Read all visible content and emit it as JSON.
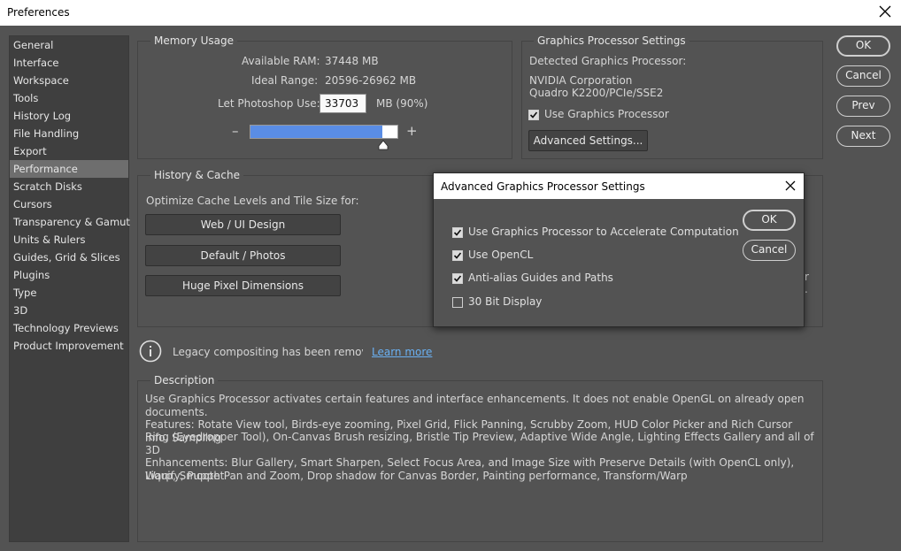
{
  "window": {
    "title": "Preferences"
  },
  "sidebar": {
    "items": [
      {
        "label": "General"
      },
      {
        "label": "Interface"
      },
      {
        "label": "Workspace"
      },
      {
        "label": "Tools"
      },
      {
        "label": "History Log"
      },
      {
        "label": "File Handling"
      },
      {
        "label": "Export"
      },
      {
        "label": "Performance"
      },
      {
        "label": "Scratch Disks"
      },
      {
        "label": "Cursors"
      },
      {
        "label": "Transparency & Gamut"
      },
      {
        "label": "Units & Rulers"
      },
      {
        "label": "Guides, Grid & Slices"
      },
      {
        "label": "Plugins"
      },
      {
        "label": "Type"
      },
      {
        "label": "3D"
      },
      {
        "label": "Technology Previews"
      },
      {
        "label": "Product Improvement"
      }
    ],
    "active": "Performance"
  },
  "memory": {
    "title": "Memory Usage",
    "available_label": "Available RAM:",
    "available_value": "37448 MB",
    "ideal_label": "Ideal Range:",
    "ideal_value": "20596-26962 MB",
    "let_label": "Let Photoshop Use:",
    "let_value": "33703",
    "let_unit": "MB (90%)",
    "minus": "–",
    "plus": "+",
    "slider_fraction": 0.9
  },
  "gpu": {
    "title": "Graphics Processor Settings",
    "detected_label": "Detected Graphics Processor:",
    "vendor": "NVIDIA Corporation",
    "model": "Quadro K2200/PCIe/SSE2",
    "use_gpu_label": "Use Graphics Processor",
    "advanced_button": "Advanced Settings..."
  },
  "history": {
    "title": "History & Cache",
    "optimize_label": "Optimize Cache Levels and Tile Size for:",
    "buttons": [
      "Web / UI Design",
      "Default / Photos",
      "Huge Pixel Dimensions"
    ],
    "partial_right_1": "r",
    "partial_right_2": "."
  },
  "notice": {
    "text": "Legacy compositing has been removec",
    "link": "Learn more"
  },
  "description": {
    "title": "Description",
    "p1": "Use Graphics Processor activates certain features and interface enhancements. It does not enable OpenGL on already open documents.",
    "p2_line1": "Features: Rotate View tool, Birds-eye zooming, Pixel Grid, Flick Panning, Scrubby Zoom, HUD Color Picker and Rich Cursor info, Sampling",
    "p2_line2": "Ring (Eyedropper Tool), On-Canvas Brush resizing, Bristle Tip Preview, Adaptive Wide Angle, Lighting Effects Gallery and all of 3D",
    "p3_line1": "Enhancements: Blur Gallery, Smart Sharpen, Select Focus Area, and Image Size with Preserve Details (with OpenCL only), Liquify, Puppet",
    "p3_line2": "Warp, Smooth Pan and Zoom, Drop shadow for Canvas Border, Painting performance, Transform/Warp"
  },
  "actions": {
    "ok": "OK",
    "cancel": "Cancel",
    "prev": "Prev",
    "next": "Next"
  },
  "dialog": {
    "title": "Advanced Graphics Processor Settings",
    "options": [
      {
        "label": "Use Graphics Processor to Accelerate Computation",
        "checked": true
      },
      {
        "label": "Use OpenCL",
        "checked": true
      },
      {
        "label": "Anti-alias Guides and Paths",
        "checked": true
      },
      {
        "label": "30 Bit Display",
        "checked": false
      }
    ],
    "ok": "OK",
    "cancel": "Cancel"
  }
}
